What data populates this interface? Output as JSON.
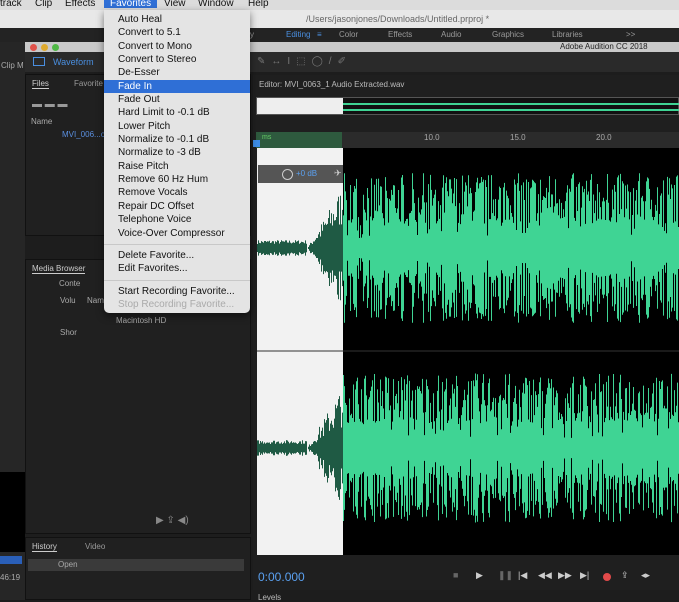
{
  "menubar": {
    "items": [
      "track",
      "Clip",
      "Effects",
      "Favorites",
      "View",
      "Window",
      "Help"
    ],
    "active": "Favorites"
  },
  "premiere": {
    "path": "/Users/jasonjones/Downloads/Untitled.prproj *",
    "workspaces": [
      "y",
      "Editing",
      "Color",
      "Effects",
      "Audio",
      "Graphics",
      "Libraries",
      ">>"
    ],
    "active_workspace": "Editing",
    "clip_label": "Clip M",
    "timecode": "46:19"
  },
  "audition": {
    "title": "Adobe Audition CC 2018",
    "waveform_tab": "Waveform"
  },
  "files_panel": {
    "tabs": [
      "Files",
      "Favorite"
    ],
    "column": "Name",
    "item": "MVI_006...o"
  },
  "media_browser": {
    "tab": "Media Browser",
    "tree": [
      "Volu",
      "Shor"
    ],
    "content_label": "Conte",
    "name_col": "Nam",
    "item": "Macintosh HD"
  },
  "history": {
    "tabs": [
      "History",
      "Video"
    ],
    "items": [
      "Open"
    ]
  },
  "favorites_menu": {
    "groups": [
      [
        "Auto Heal",
        "Convert to 5.1",
        "Convert to Mono",
        "Convert to Stereo",
        "De-Esser",
        "Fade In",
        "Fade Out",
        "Hard Limit to -0.1 dB",
        "Lower Pitch",
        "Normalize to -0.1 dB",
        "Normalize to -3 dB",
        "Raise Pitch",
        "Remove 60 Hz Hum",
        "Remove Vocals",
        "Repair DC Offset",
        "Telephone Voice",
        "Voice-Over Compressor"
      ],
      [
        "Delete Favorite...",
        "Edit Favorites..."
      ],
      [
        "Start Recording Favorite...",
        "Stop Recording Favorite..."
      ]
    ],
    "highlighted": "Fade In",
    "disabled": [
      "Stop Recording Favorite..."
    ]
  },
  "editor": {
    "title": "Editor: MVI_0063_1 Audio Extracted.wav",
    "ruler": {
      "unit": "ms",
      "ticks": [
        "10.0",
        "15.0",
        "20.0"
      ]
    },
    "gain": "+0 dB",
    "time": "0:00.000",
    "colors": {
      "wave": "#3fd494",
      "fade_wave": "#1f5a44",
      "selection": "#f2f2f2"
    }
  },
  "levels": {
    "tab": "Levels"
  }
}
